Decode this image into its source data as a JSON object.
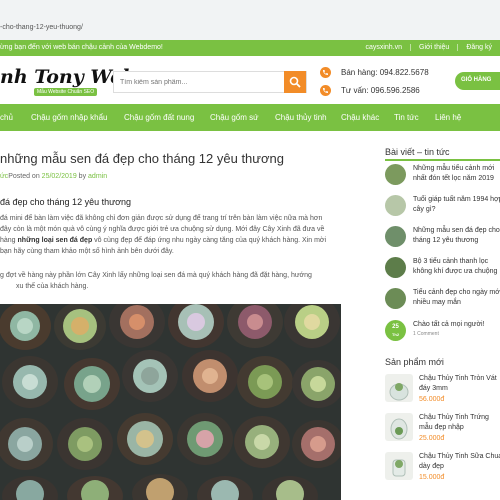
{
  "browser": {
    "url": "-cho-thang-12-yeu-thuong/"
  },
  "topbar": {
    "welcome": "ừng bạn đến với web bán chậu cảnh của Webdemo!",
    "links": [
      "caysxinh.vn",
      "Giới thiệu",
      "Đăng ký"
    ]
  },
  "header": {
    "logo": "nh Tony Web",
    "logo_sub": "Mẫu Website Chuẩn SEO",
    "search_placeholder": "Tìm kiếm sản phẩm...",
    "sales_phone": "Bán hàng: 094.822.5678",
    "consult_phone": "Tư vấn: 096.596.2586",
    "cart": "GIỎ HÀNG"
  },
  "nav": [
    "chủ",
    "Chậu gốm nhập khẩu",
    "Chậu gốm đất nung",
    "Chậu gốm sứ",
    "Chậu thủy tinh",
    "Chậu khác",
    "Tin tức",
    "Liên hệ"
  ],
  "post": {
    "title": "những mẫu sen đá đẹp cho tháng 12 yêu thương",
    "meta_category": "ức",
    "meta_posted": "Posted on",
    "meta_date": "25/02/2019",
    "meta_by": "by",
    "meta_author": "admin",
    "heading": "đá đẹp cho tháng 12 yêu thương",
    "p1_line1": "đá mini để bàn làm việc đã không chỉ đơn giản được sử dụng để trang trí trên bàn làm việc nữa mà hơn",
    "p1_line2": "đây còn là một món quà vô cùng ý nghĩa được giới trẻ ưa chuộng sử dụng. Mới đây Cây Xinh đã đưa về",
    "p1_line3_pre": "hàng ",
    "p1_line3_bold": "những loại sen đá đẹp",
    "p1_line3_post": " vô cùng đẹp để đáp ứng nhu ngày càng tăng của quý khách hàng. Xin mời",
    "p1_line4": "bạn hãy cùng tham khảo một số hình ảnh bên dưới đây.",
    "p2_line1": "g đợt về hàng này phần lớn Cây Xinh lấy những loại sen đá mà quý khách hàng đã đặt hàng, hướng",
    "p2_line2": "xu thế của khách hàng."
  },
  "sidebar": {
    "news_title": "Bài viết – tin tức",
    "news": [
      "Những mẫu tiểu cảnh mới nhất đón tết lọc năm 2019",
      "Tuổi giáp tuất năm 1994 hợp cây gì?",
      "Những mẫu sen đá đẹp cho tháng 12 yêu thương",
      "Bộ 3 tiểu cảnh thanh lọc không khí được ưa chuộng",
      "Tiểu cảnh đẹp cho ngày mới nhiều may mắn"
    ],
    "comment_date_day": "25",
    "comment_date_month": "Th2",
    "comment_title": "Chào tất cả mọi người!",
    "comment_count": "1 Comment",
    "products_title": "Sản phẩm mới",
    "products": [
      {
        "name": "Chậu Thủy Tinh Tròn Vát đáy 3mm",
        "price": "56.000đ"
      },
      {
        "name": "Chậu Thủy Tinh Trứng mẫu đẹp nhập",
        "price": "25.000đ"
      },
      {
        "name": "Chậu Thủy Tinh Sữa Chua dày đẹp",
        "price": "15.000đ"
      }
    ]
  },
  "colors": {
    "green": "#7ac142",
    "orange": "#f28c28"
  }
}
